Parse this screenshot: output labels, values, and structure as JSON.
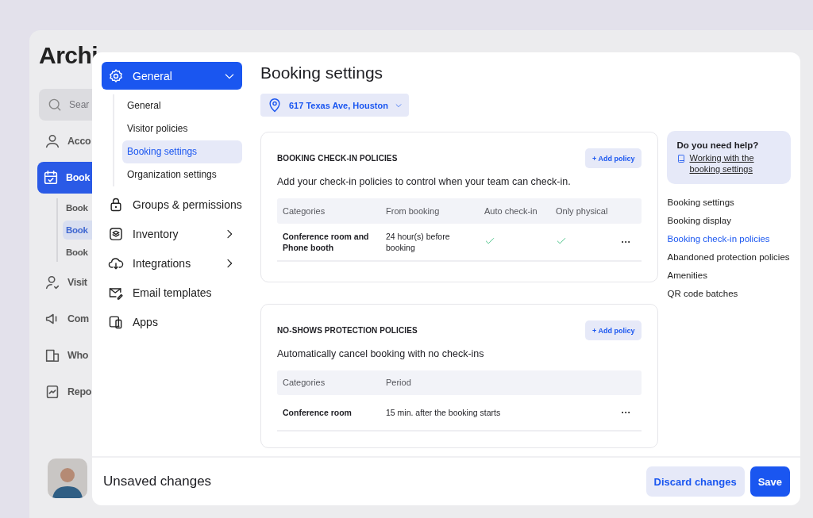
{
  "background_app": {
    "logo": "Archi",
    "search": {
      "placeholder": "Sear"
    },
    "nav_items": [
      {
        "label": "Acco",
        "selected": false
      },
      {
        "label": "Book",
        "selected": true,
        "children": [
          {
            "label": "Book",
            "selected": false
          },
          {
            "label": "Book",
            "selected": true
          },
          {
            "label": "Book",
            "selected": false
          }
        ]
      },
      {
        "label": "Visit",
        "selected": false
      },
      {
        "label": "Com",
        "selected": false
      },
      {
        "label": "Who",
        "selected": false
      },
      {
        "label": "Repo",
        "selected": false
      }
    ]
  },
  "settings_nav": {
    "items": [
      {
        "label": "General",
        "selected": true,
        "expanded": true,
        "children": [
          {
            "label": "General",
            "selected": false
          },
          {
            "label": "Visitor policies",
            "selected": false
          },
          {
            "label": "Booking settings",
            "selected": true
          },
          {
            "label": "Organization settings",
            "selected": false
          }
        ]
      },
      {
        "label": "Groups & permissions",
        "selected": false
      },
      {
        "label": "Inventory",
        "selected": false,
        "expanded": false
      },
      {
        "label": "Integrations",
        "selected": false,
        "expanded": false
      },
      {
        "label": "Email templates",
        "selected": false
      },
      {
        "label": "Apps",
        "selected": false
      }
    ]
  },
  "page": {
    "title": "Booking settings",
    "location": "617 Texas Ave, Houston",
    "sections": [
      {
        "title": "BOOKING CHECK-IN POLICIES",
        "add_button": "+ Add policy",
        "description": "Add your check-in policies to control when your team can check-in.",
        "columns": [
          "Categories",
          "From booking",
          "Auto check-in",
          "Only physical"
        ],
        "rows": [
          {
            "cells": [
              {
                "kind": "text",
                "text": "Conference room and Phone booth"
              },
              {
                "kind": "text",
                "text": "24 hour(s) before booking"
              },
              {
                "kind": "check",
                "checked": true
              },
              {
                "kind": "check",
                "checked": true
              }
            ],
            "actions": "···"
          }
        ]
      },
      {
        "title": "NO-SHOWS PROTECTION POLICIES",
        "add_button": "+ Add policy",
        "description": "Automatically cancel booking with no check-ins",
        "columns": [
          "Categories",
          "Period"
        ],
        "rows": [
          {
            "cells": [
              {
                "kind": "text",
                "text": "Conference room"
              },
              {
                "kind": "text",
                "text": "15 min. after the booking starts"
              }
            ],
            "actions": "···"
          }
        ]
      }
    ]
  },
  "help": {
    "title": "Do you need help?",
    "link": "Working with the booking settings"
  },
  "toc": [
    {
      "label": "Booking settings",
      "selected": false
    },
    {
      "label": "Booking display",
      "selected": false
    },
    {
      "label": "Booking check-in policies",
      "selected": true
    },
    {
      "label": "Abandoned protection policies",
      "selected": false
    },
    {
      "label": "Amenities",
      "selected": false
    },
    {
      "label": "QR code batches",
      "selected": false
    }
  ],
  "footer": {
    "message": "Unsaved changes",
    "buttons": [
      {
        "label": "Discard changes",
        "kind": "secondary"
      },
      {
        "label": "Save",
        "kind": "primary"
      }
    ]
  }
}
